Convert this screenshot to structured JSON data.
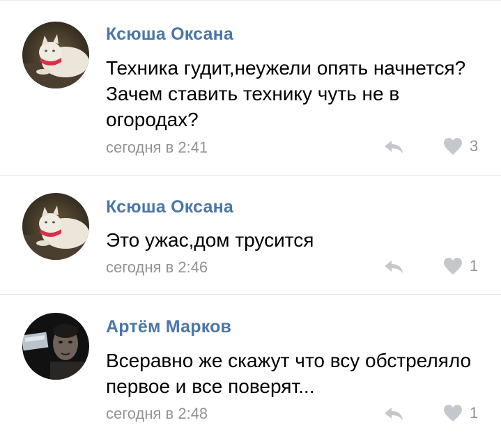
{
  "comments": [
    {
      "author": "Ксюша Оксана",
      "text": "Техника гудит,неужели опять начнется? Зачем ставить технику чуть не в огородах?",
      "time": "сегодня в 2:41",
      "likes": "3",
      "avatar": "cat-photo"
    },
    {
      "author": "Ксюша Оксана",
      "text": "Это ужас,дом трусится",
      "time": "сегодня в 2:46",
      "likes": "1",
      "avatar": "cat-photo"
    },
    {
      "author": "Артём Марков",
      "text": "Всеравно же скажут что всу обстреляло первое и все поверят...",
      "time": "сегодня в 2:48",
      "likes": "1",
      "avatar": "man-photo"
    }
  ],
  "icons": {
    "reply": "reply-icon",
    "like": "heart-icon"
  },
  "colors": {
    "author": "#4a76a8",
    "meta": "#939393",
    "icon": "#c4c8cc",
    "divider": "#e3e4e8"
  }
}
